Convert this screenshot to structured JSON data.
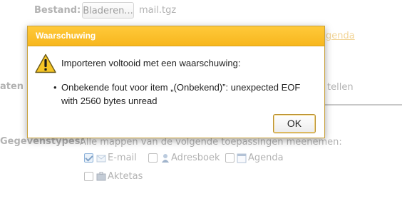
{
  "form": {
    "file_label": "Bestand:",
    "browse_button": "Bladeren...",
    "file_name": "mail.tgz",
    "partial_link": "genda",
    "partial_label_left": "aten v",
    "partial_text_right": "tellen",
    "datatypes_label": "Gegevenstypes:",
    "datatypes_description": "Alle mappen van de volgende toepassingen meenemen:",
    "apps": [
      {
        "label": "E-mail",
        "checked": true,
        "icon": "mail-icon"
      },
      {
        "label": "Adresboek",
        "checked": false,
        "icon": "contact-icon"
      },
      {
        "label": "Agenda",
        "checked": false,
        "icon": "calendar-icon"
      },
      {
        "label": "Aktetas",
        "checked": false,
        "icon": "briefcase-icon"
      }
    ]
  },
  "dialog": {
    "title": "Waarschuwing",
    "icon": "warning-icon",
    "message": "Importeren voltooid met een waarschuwing:",
    "details": [
      "Onbekende fout voor item „(Onbekend)”: unexpected EOF",
      "with 2560 bytes unread"
    ],
    "ok_button": "OK"
  },
  "colors": {
    "dialog_title_bar": "#f7b71e",
    "dialog_border": "#c9a13a",
    "link": "#e8b64b",
    "checkbox_checked": "#3b7bbf"
  }
}
